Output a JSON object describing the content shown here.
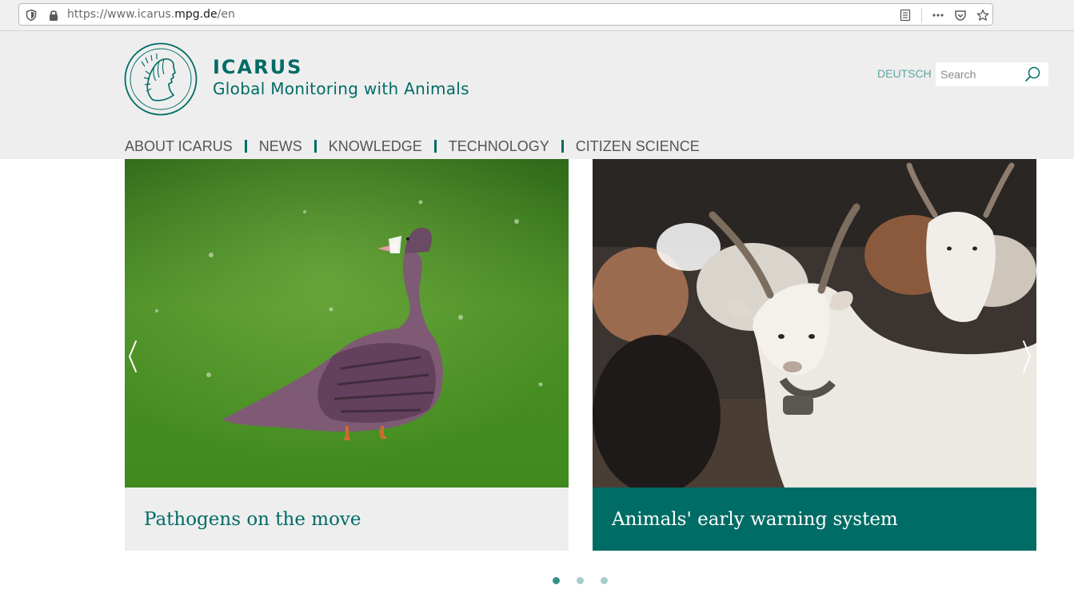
{
  "browser": {
    "url_prefix": "https://www.icarus.",
    "url_domain": "mpg.de",
    "url_suffix": "/en"
  },
  "header": {
    "title": "ICARUS",
    "subtitle": "Global Monitoring with Animals",
    "language_link": "DEUTSCH",
    "search_placeholder": "Search"
  },
  "nav": {
    "items": [
      {
        "label": "ABOUT ICARUS"
      },
      {
        "label": "NEWS"
      },
      {
        "label": "KNOWLEDGE"
      },
      {
        "label": "TECHNOLOGY"
      },
      {
        "label": "CITIZEN SCIENCE"
      }
    ]
  },
  "carousel": {
    "slides": [
      {
        "caption": "Pathogens on the move",
        "image": "goose-on-grass-photo"
      },
      {
        "caption": "Animals' early warning system",
        "image": "goats-with-collars-photo"
      }
    ],
    "active_dot": 1,
    "dot_count": 3
  },
  "colors": {
    "brand": "#006c66",
    "header_bg": "#eeeeee",
    "dot_active": "#3a8f8a",
    "dot_inactive": "#a6cfcc"
  }
}
